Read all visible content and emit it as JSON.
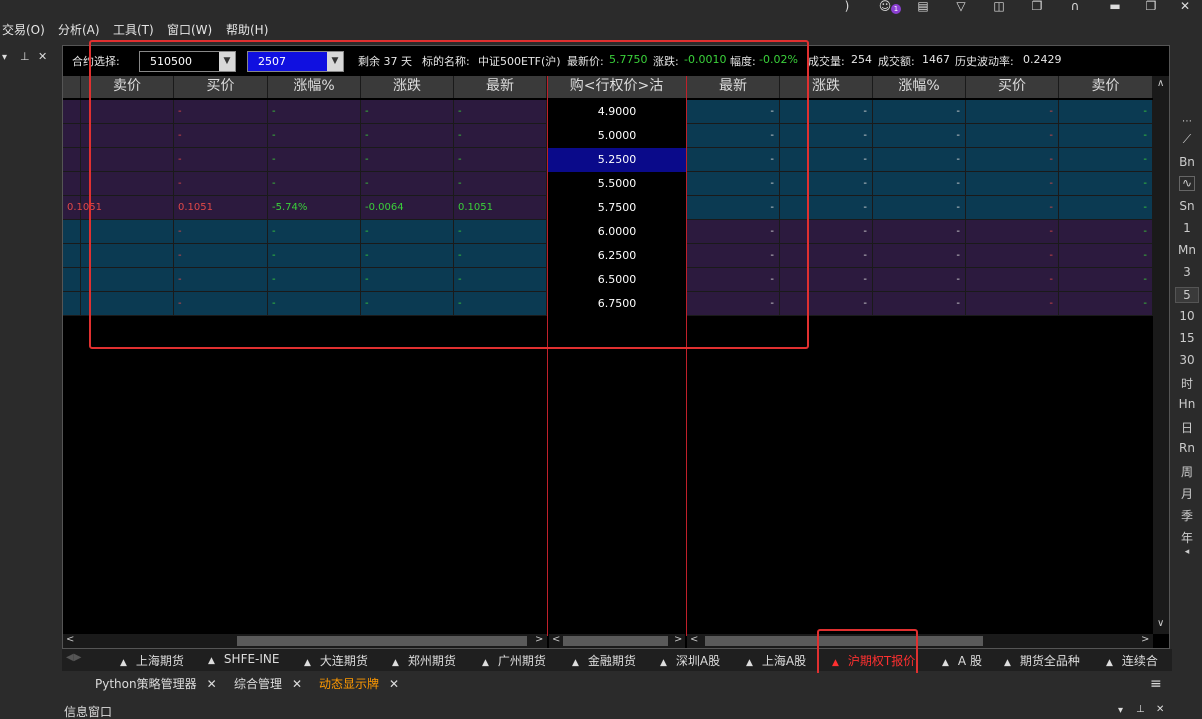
{
  "menu": [
    "交易(O)",
    "分析(A)",
    "工具(T)",
    "窗口(W)",
    "帮助(H)"
  ],
  "title_icons": [
    "rss-icon",
    "user-icon",
    "document-icon",
    "cart-icon",
    "chart-icon",
    "copy-icon",
    "headset-icon",
    "minimize-icon",
    "restore-icon",
    "close-icon"
  ],
  "user_badge": "1",
  "leftpane": {
    "controls": [
      "▾",
      "⊥",
      "✕"
    ]
  },
  "info": {
    "contract_label": "合约选择:",
    "underlying": "510500",
    "month": "2507",
    "remaining": "剩余 37 天",
    "name_label": "标的名称:",
    "name_value": "中证500ETF(沪)",
    "last_label": "最新价:",
    "last_value": "5.7750",
    "chg_label": "涨跌:",
    "chg_value": "-0.0010",
    "pct_label": "幅度:",
    "pct_value": "-0.02%",
    "vol_label": "成交量:",
    "vol_value": "254",
    "amt_label": "成交额:",
    "amt_value": "1467",
    "hv_label": "历史波动率:",
    "hv_value": "0.2429"
  },
  "headers_left": [
    "卖价",
    "买价",
    "涨幅%",
    "涨跌",
    "最新"
  ],
  "header_center": "购<行权价>沽",
  "headers_right": [
    "最新",
    "涨跌",
    "涨幅%",
    "买价",
    "卖价"
  ],
  "rows": [
    {
      "strike": "4.9000",
      "left": [
        "",
        "-",
        "-",
        "-",
        "-"
      ],
      "right": [
        "-",
        "-",
        "-",
        "-",
        "-"
      ]
    },
    {
      "strike": "5.0000",
      "left": [
        "",
        "-",
        "-",
        "-",
        "-"
      ],
      "right": [
        "-",
        "-",
        "-",
        "-",
        "-"
      ]
    },
    {
      "strike": "5.2500",
      "left": [
        "",
        "-",
        "-",
        "-",
        "-"
      ],
      "right": [
        "-",
        "-",
        "-",
        "-",
        "-"
      ]
    },
    {
      "strike": "5.5000",
      "left": [
        "",
        "-",
        "-",
        "-",
        "-"
      ],
      "right": [
        "-",
        "-",
        "-",
        "-",
        "-"
      ]
    },
    {
      "strike": "5.7500",
      "left": [
        "0.1051",
        "0.1051",
        "-5.74%",
        "-0.0064",
        "0.1051"
      ],
      "right": [
        "-",
        "-",
        "-",
        "-",
        "-"
      ]
    },
    {
      "strike": "6.0000",
      "left": [
        "",
        "-",
        "-",
        "-",
        "-"
      ],
      "right": [
        "-",
        "-",
        "-",
        "-",
        "-"
      ]
    },
    {
      "strike": "6.2500",
      "left": [
        "",
        "-",
        "-",
        "-",
        "-"
      ],
      "right": [
        "-",
        "-",
        "-",
        "-",
        "-"
      ]
    },
    {
      "strike": "6.5000",
      "left": [
        "",
        "-",
        "-",
        "-",
        "-"
      ],
      "right": [
        "-",
        "-",
        "-",
        "-",
        "-"
      ]
    },
    {
      "strike": "6.7500",
      "left": [
        "",
        "-",
        "-",
        "-",
        "-"
      ],
      "right": [
        "-",
        "-",
        "-",
        "-",
        "-"
      ]
    }
  ],
  "market_tabs": [
    "上海期货",
    "SHFE-INE",
    "大连期货",
    "郑州期货",
    "广州期货",
    "金融期货",
    "深圳A股",
    "上海A股",
    "沪期权T报价",
    "A 股",
    "期货全品种",
    "连续合"
  ],
  "tab_marker": "▲",
  "doc_tabs": [
    "Python策略管理器",
    "综合管理",
    "动态显示牌"
  ],
  "bottom_pane_title": "信息窗口",
  "right_toolbar": [
    "Bn",
    "Sn",
    "1",
    "Mn",
    "3",
    "5",
    "10",
    "15",
    "30",
    "时",
    "Hn",
    "日",
    "Rn",
    "周",
    "月",
    "季",
    "年"
  ],
  "colors": {
    "call_itm": "#2c1a3e",
    "put_itm": "#0b3a52",
    "up": "#e04848",
    "down": "#3ad03a",
    "strike_selected": "#0a0a8a",
    "accent_tab": "#ff3030",
    "doc_tab_active": "#ff9900"
  }
}
